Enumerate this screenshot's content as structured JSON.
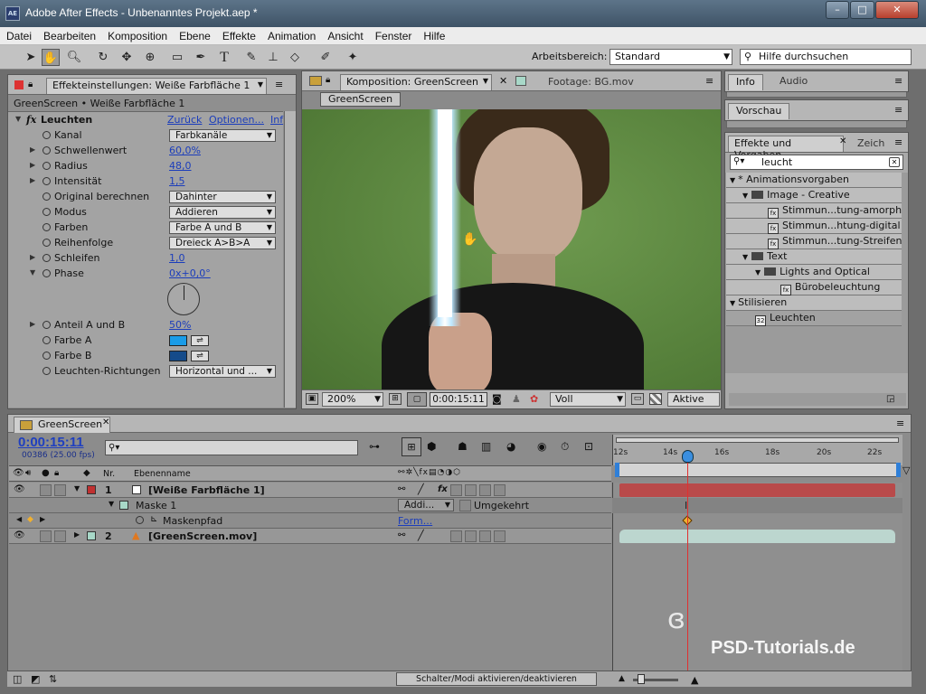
{
  "app": {
    "icon_text": "AE",
    "title": "Adobe After Effects - Unbenanntes Projekt.aep *",
    "window_buttons": [
      "–",
      "□",
      "✕"
    ]
  },
  "menu": [
    "Datei",
    "Bearbeiten",
    "Komposition",
    "Ebene",
    "Effekte",
    "Animation",
    "Ansicht",
    "Fenster",
    "Hilfe"
  ],
  "toolbar": {
    "workspace_label": "Arbeitsbereich:",
    "workspace_value": "Standard",
    "help_search": "Hilfe durchsuchen"
  },
  "effect_panel": {
    "tab": "Effekteinstellungen: Weiße Farbfläche 1",
    "breadcrumb": "GreenScreen • Weiße Farbfläche 1",
    "effect_name": "Leuchten",
    "fx_label": "fx",
    "links": [
      "Zurück",
      "Optionen...",
      "Inf"
    ],
    "params": [
      {
        "label": "Kanal",
        "dropdown": "Farbkanäle"
      },
      {
        "label": "Schwellenwert",
        "value": "60,0%"
      },
      {
        "label": "Radius",
        "value": "48,0"
      },
      {
        "label": "Intensität",
        "value": "1,5"
      },
      {
        "label": "Original berechnen",
        "dropdown": "Dahinter"
      },
      {
        "label": "Modus",
        "dropdown": "Addieren"
      },
      {
        "label": "Farben",
        "dropdown": "Farbe A und B"
      },
      {
        "label": "Reihenfolge",
        "dropdown": "Dreieck A>B>A"
      },
      {
        "label": "Schleifen",
        "value": "1,0"
      },
      {
        "label": "Phase",
        "value": "0x+0,0°"
      },
      {
        "label": "Anteil A und B",
        "value": "50%"
      },
      {
        "label": "Farbe A",
        "color": "#1a9ce8"
      },
      {
        "label": "Farbe B",
        "color": "#154b8a"
      },
      {
        "label": "Leuchten-Richtungen",
        "dropdown": "Horizontal und ..."
      }
    ]
  },
  "comp_panel": {
    "tab": "Komposition: GreenScreen",
    "footage_tab": "Footage: BG.mov",
    "sub_tab": "GreenScreen",
    "zoom": "200%",
    "timecode": "0:00:15:11",
    "resolution": "Voll",
    "camera": "Aktive Kar"
  },
  "right_panels": {
    "info_tab": "Info",
    "audio_tab": "Audio",
    "preview_tab": "Vorschau",
    "effects_tab": "Effekte und Vorgaben",
    "zeichen_tab": "Zeich",
    "search_value": "leucht",
    "tree": [
      {
        "label": "* Animationsvorgaben",
        "indent": 0,
        "kind": "root"
      },
      {
        "label": "Image - Creative",
        "indent": 1,
        "kind": "folder"
      },
      {
        "label": "Stimmun...tung-amorph",
        "indent": 3,
        "kind": "preset"
      },
      {
        "label": "Stimmun...htung-digital",
        "indent": 3,
        "kind": "preset"
      },
      {
        "label": "Stimmun...tung-Streifen",
        "indent": 3,
        "kind": "preset"
      },
      {
        "label": "Text",
        "indent": 1,
        "kind": "folder"
      },
      {
        "label": "Lights and Optical",
        "indent": 2,
        "kind": "folder"
      },
      {
        "label": "Bürobeleuchtung",
        "indent": 4,
        "kind": "preset"
      },
      {
        "label": "Stilisieren",
        "indent": 0,
        "kind": "root"
      },
      {
        "label": "Leuchten",
        "indent": 2,
        "kind": "effect",
        "selected": true
      }
    ]
  },
  "timeline": {
    "tab": "GreenScreen",
    "timecode": "0:00:15:11",
    "frame_info": "00386 (25.00 fps)",
    "col_nr": "Nr.",
    "col_name": "Ebenenname",
    "ticks": [
      "12s",
      "14s",
      "16s",
      "18s",
      "20s",
      "22s"
    ],
    "layers": [
      {
        "nr": "1",
        "name": "[Weiße Farbfläche 1]",
        "label_color": "#c03030"
      },
      {
        "nr": "",
        "name": "Maske 1",
        "mode": "Addi...",
        "extra": "Umgekehrt"
      },
      {
        "nr": "",
        "name": "Maskenpfad",
        "mode": "Form..."
      },
      {
        "nr": "2",
        "name": "[GreenScreen.mov]",
        "label_color": "#a8d8c8"
      }
    ],
    "toggle_label": "Schalter/Modi aktivieren/deaktivieren"
  },
  "watermark": "PSD-Tutorials.de",
  "colors": {
    "layer1_bar": "#b94a4a",
    "layer2_bar": "#bcd6cf",
    "playhead": "#e03030",
    "link_blue": "#1b3dbb"
  }
}
